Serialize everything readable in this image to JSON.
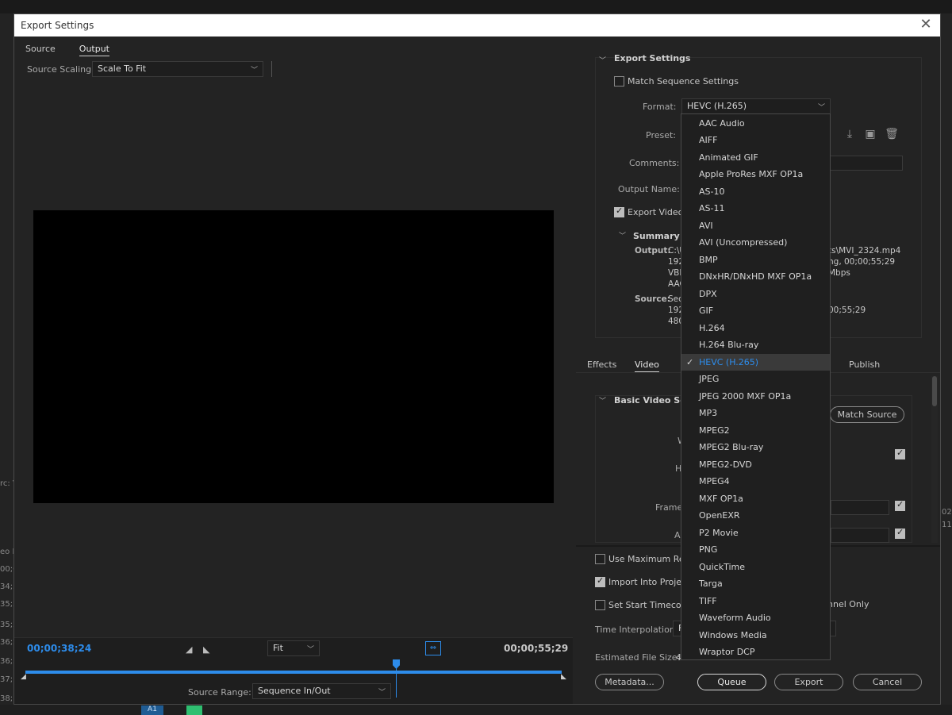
{
  "dialog": {
    "title": "Export Settings"
  },
  "left": {
    "tabs": [
      "Source",
      "Output"
    ],
    "source_scaling_label": "Source Scaling:",
    "source_scaling_value": "Scale To Fit",
    "timecode_in": "00;00;38;24",
    "timecode_out": "00;00;55;29",
    "zoom_value": "Fit",
    "source_range_label": "Source Range:",
    "source_range_value": "Sequence In/Out"
  },
  "right": {
    "export_settings_head": "Export Settings",
    "match_sequence_label": "Match Sequence Settings",
    "format_label": "Format:",
    "format_value": "HEVC (H.265)",
    "preset_label": "Preset:",
    "comments_label": "Comments:",
    "output_name_label": "Output Name:",
    "export_video_label": "Export Video",
    "summary_head": "Summary",
    "summary_output_label": "Output:",
    "summary_output_lines": [
      "C:\\U",
      "192",
      "VBR",
      "AAC"
    ],
    "summary_output_right": [
      "ts\\MVI_2324.mp4",
      "ng, 00;00;55;29",
      "Mbps"
    ],
    "summary_source_label": "Source:",
    "summary_source_lines": [
      "Seq",
      "192",
      "480"
    ],
    "summary_source_right": [
      "00;55;29"
    ],
    "tabs": [
      "Effects",
      "Video",
      "Publish"
    ],
    "basic_video_head": "Basic Video Setti",
    "match_source_label": "Match Source",
    "partial_labels": [
      "W",
      "H",
      "Frame",
      "As"
    ],
    "use_max_render_label": "Use Maximum Ren",
    "import_project_label": "Import Into Project",
    "set_start_tc_label": "Set Start Timecode",
    "channel_only_label": "nnel Only",
    "time_interp_label": "Time Interpolation:",
    "time_interp_value": "F",
    "est_file_size_label": "Estimated File Size:",
    "est_file_size_value": "4",
    "buttons": {
      "metadata": "Metadata...",
      "queue": "Queue",
      "export": "Export",
      "cancel": "Cancel"
    }
  },
  "format_dropdown": {
    "selected": "HEVC (H.265)",
    "items": [
      "AAC Audio",
      "AIFF",
      "Animated GIF",
      "Apple ProRes MXF OP1a",
      "AS-10",
      "AS-11",
      "AVI",
      "AVI (Uncompressed)",
      "BMP",
      "DNxHR/DNxHD MXF OP1a",
      "DPX",
      "GIF",
      "H.264",
      "H.264 Blu-ray",
      "HEVC (H.265)",
      "JPEG",
      "JPEG 2000 MXF OP1a",
      "MP3",
      "MPEG2",
      "MPEG2 Blu-ray",
      "MPEG2-DVD",
      "MPEG4",
      "MXF OP1a",
      "OpenEXR",
      "P2 Movie",
      "PNG",
      "QuickTime",
      "Targa",
      "TIFF",
      "Waveform Audio",
      "Windows Media",
      "Wraptor DCP"
    ]
  },
  "background": {
    "left_fragments": [
      "rc: V",
      "eo In",
      "00;0",
      "34;5",
      "35;2",
      "35;2",
      "36;2",
      "36;5",
      "37;1",
      "38;1"
    ],
    "right_fragments": [
      "02",
      "11"
    ],
    "track_label": "A1"
  },
  "colors": {
    "accent": "#2d8ceb",
    "selected_item_bg": "#3a3a3a"
  }
}
